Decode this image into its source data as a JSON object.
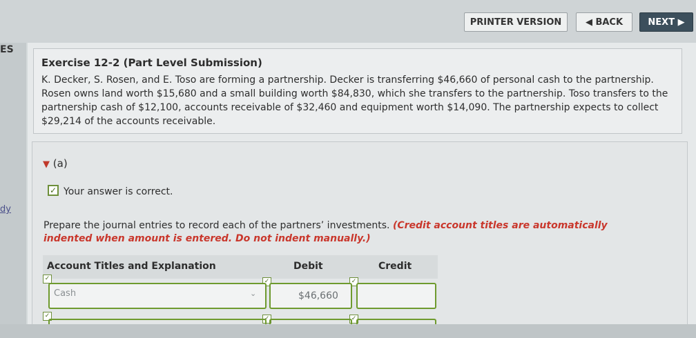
{
  "toolbar": {
    "printer_label": "PRINTER VERSION",
    "back_label": "◀ BACK",
    "next_label": "NEXT ▶"
  },
  "left_nav": {
    "top_label": "ES",
    "mid_label": "dy"
  },
  "exercise": {
    "title": "Exercise 12-2 (Part Level Submission)",
    "text": "K. Decker, S. Rosen, and E. Toso are forming a partnership. Decker is transferring $46,660 of personal cash to the partnership. Rosen owns land worth $15,680 and a small building worth $84,830, which she transfers to the partnership. Toso transfers to the partnership cash of $12,100, accounts receivable of $32,460 and equipment worth $14,090. The partnership expects to collect $29,214 of the accounts receivable."
  },
  "part": {
    "label": "(a)",
    "status": "Your answer is correct.",
    "instructions": "Prepare the journal entries to record each of the partners’ investments.",
    "note": "(Credit account titles are automatically indented when amount is entered. Do not indent manually.)"
  },
  "table": {
    "headers": {
      "account": "Account Titles and Explanation",
      "debit": "Debit",
      "credit": "Credit"
    },
    "rows": [
      {
        "account": "Cash",
        "debit": "$46,660",
        "credit": ""
      }
    ]
  },
  "colors": {
    "accent_green": "#6e9a2e",
    "note_red": "#c9372c",
    "next_button": "#3c4f5c"
  }
}
